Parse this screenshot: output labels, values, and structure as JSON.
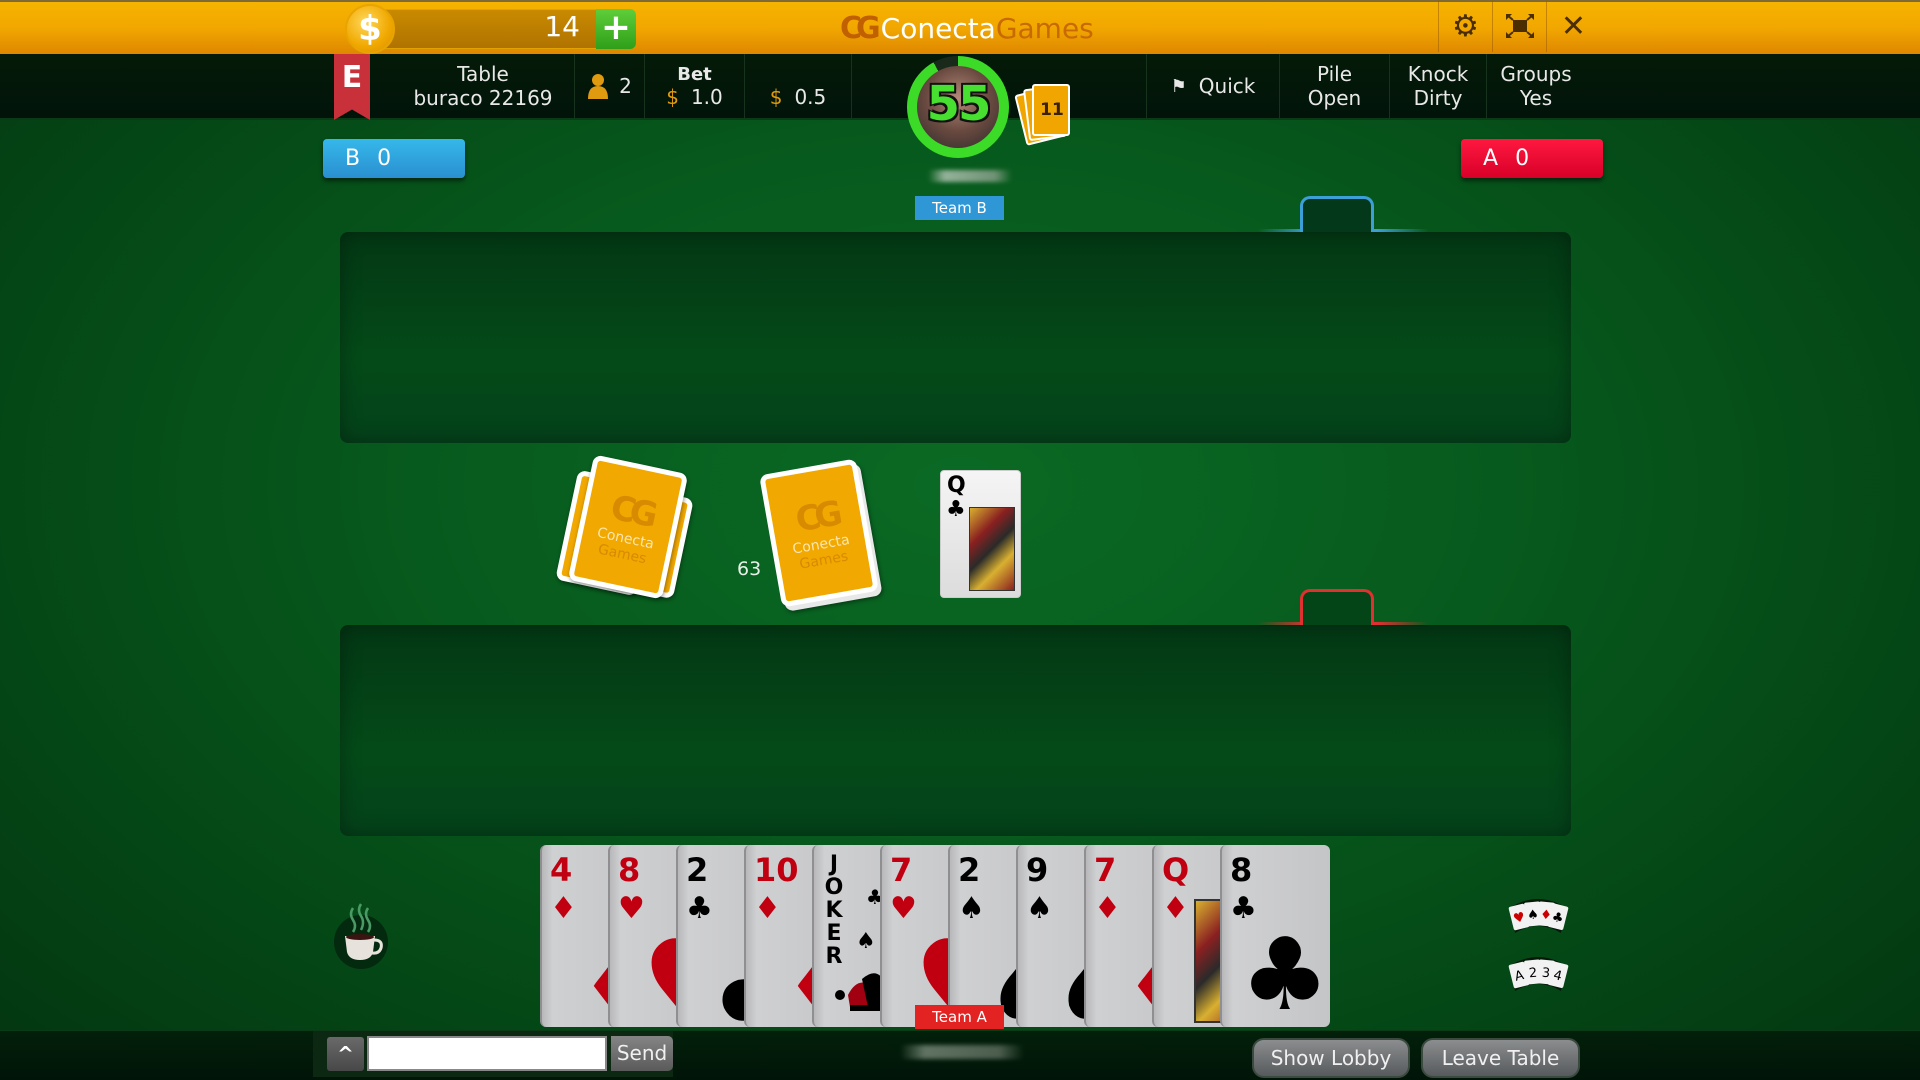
{
  "header": {
    "coins": "14",
    "add_coins_icon": "plus-icon",
    "coin_icon": "$",
    "logo_primary": "Conecta",
    "logo_secondary": "Games",
    "buttons": [
      {
        "name": "settings",
        "icon": "gear-icon",
        "glyph": "⚙"
      },
      {
        "name": "fullscreen",
        "icon": "fullscreen-icon",
        "glyph": "⤧"
      },
      {
        "name": "close",
        "icon": "close-icon",
        "glyph": "✕"
      }
    ]
  },
  "info_bar": {
    "ribbon_letter": "E",
    "table_label": "Table",
    "table_name": "buraco 22169",
    "players_count": "2",
    "bet_label": "Bet",
    "currency_symbol": "$",
    "bet_value": "1.0",
    "secondary_value": "0.5",
    "speed": "Quick",
    "rules": [
      {
        "label": "Pile",
        "value": "Open"
      },
      {
        "label": "Knock",
        "value": "Dirty"
      },
      {
        "label": "Groups",
        "value": "Yes"
      }
    ]
  },
  "opponent": {
    "timer": "55",
    "timer_fraction": 0.92,
    "cards_in_hand": "11",
    "team_label": "Team B"
  },
  "scores": {
    "team_b": {
      "letter": "B",
      "score": "0",
      "color": "#2a9fdc"
    },
    "team_a": {
      "letter": "A",
      "score": "0",
      "color": "#e8002c"
    }
  },
  "table": {
    "stock_count": "63",
    "card_back_text_1": "Conecta",
    "card_back_text_2": "Games",
    "discard_top": {
      "rank": "Q",
      "suit": "♣",
      "color": "black"
    }
  },
  "hand": {
    "team_label": "Team A",
    "cards": [
      {
        "rank": "4",
        "suit": "♦",
        "color": "red"
      },
      {
        "rank": "8",
        "suit": "♥",
        "color": "red"
      },
      {
        "rank": "2",
        "suit": "♣",
        "color": "black"
      },
      {
        "rank": "10",
        "suit": "♦",
        "color": "red"
      },
      {
        "rank": "JOKER",
        "suit": "🃏",
        "color": "black"
      },
      {
        "rank": "7",
        "suit": "♥",
        "color": "red"
      },
      {
        "rank": "2",
        "suit": "♠",
        "color": "black"
      },
      {
        "rank": "9",
        "suit": "♠",
        "color": "black"
      },
      {
        "rank": "7",
        "suit": "♦",
        "color": "red"
      },
      {
        "rank": "Q",
        "suit": "♦",
        "color": "red"
      },
      {
        "rank": "8",
        "suit": "♣",
        "color": "black"
      }
    ]
  },
  "side_tools": {
    "coffee_icon": "coffee-break-icon",
    "sort_suits_label": "♥♠♦♣",
    "sort_ranks_label": "A234"
  },
  "chat": {
    "input_value": "",
    "input_placeholder": "",
    "send_label": "Send",
    "expand_glyph": "^"
  },
  "footer": {
    "show_lobby_label": "Show Lobby",
    "leave_table_label": "Leave Table"
  }
}
